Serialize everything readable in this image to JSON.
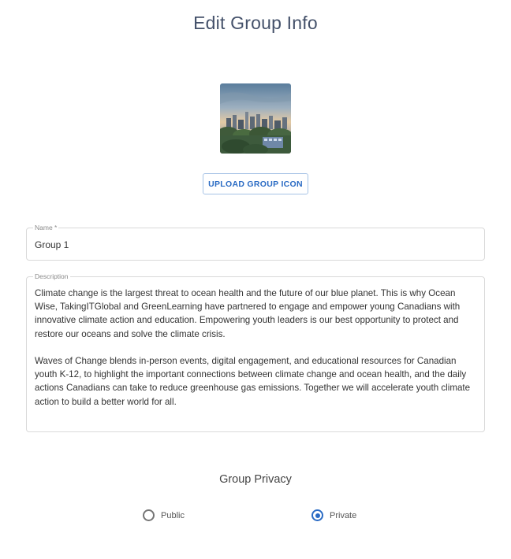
{
  "page": {
    "title": "Edit Group Info"
  },
  "group_icon": {
    "icon_name": "city-skyline-photo"
  },
  "upload_button": {
    "label": "UPLOAD GROUP ICON"
  },
  "name_field": {
    "label": "Name *",
    "value": "Group 1"
  },
  "description_field": {
    "label": "Description",
    "paragraphs": [
      "Climate change is the largest threat to ocean health and the future of our blue planet. This is why Ocean Wise, TakingITGlobal and GreenLearning have partnered to engage and empower young Canadians with innovative climate action and education. Empowering youth leaders is our best opportunity to protect and restore our oceans and solve the climate crisis.",
      "Waves of Change blends in-person events, digital engagement, and educational resources for Canadian youth K-12, to highlight the important connections between climate change and ocean health, and the daily actions Canadians can take to reduce greenhouse gas emissions. Together we will accelerate youth climate action to build a better world for all."
    ]
  },
  "privacy": {
    "title": "Group Privacy",
    "options": [
      {
        "label": "Public",
        "selected": false
      },
      {
        "label": "Private",
        "selected": true
      }
    ]
  },
  "colors": {
    "accent": "#2a6bc4",
    "title": "#44516a"
  }
}
